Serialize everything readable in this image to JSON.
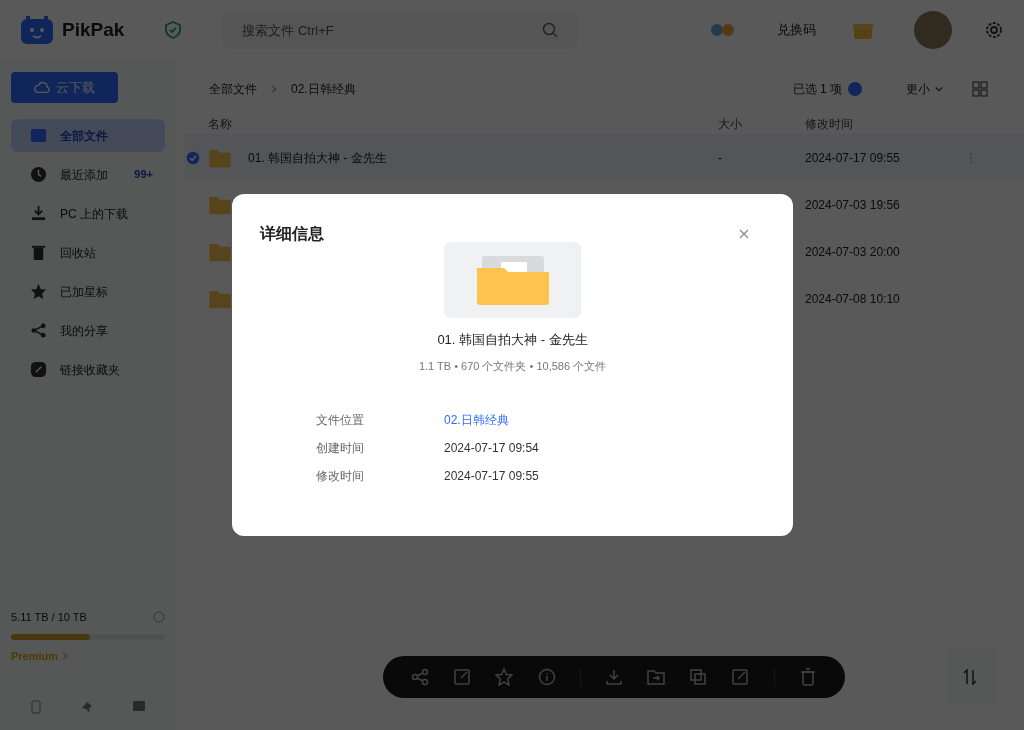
{
  "header": {
    "logo": "PikPak",
    "search": {
      "placeholder": "搜索文件 Ctrl+F"
    },
    "redeem": "兑换码"
  },
  "sidebar": {
    "cloud_download": "云下载",
    "items": [
      {
        "label": "全部文件",
        "selected": true
      },
      {
        "label": "最近添加",
        "selected": false,
        "badge": "99+"
      },
      {
        "label": "PC 上的下载",
        "selected": false
      },
      {
        "label": "回收站",
        "selected": false
      },
      {
        "label": "已加星标",
        "selected": false
      },
      {
        "label": "我的分享",
        "selected": false
      },
      {
        "label": "链接收藏夹",
        "selected": false
      }
    ],
    "storage": {
      "text": "5.11 TB / 10 TB",
      "level": 0.51,
      "plan": "Premium"
    }
  },
  "breadcrumb": [
    "全部文件",
    "02.日韩经典"
  ],
  "selection": {
    "text": "已选 1 项",
    "sort": "更小"
  },
  "table": {
    "columns": [
      "名称",
      "大小",
      "修改时间"
    ],
    "rows": [
      {
        "name": "01. 韩国自拍大神 - 金先生",
        "size": "-",
        "modified": "2024-07-17 09:55",
        "selected": true
      },
      {
        "modified": "2024-07-03 19:56",
        "selected": false
      },
      {
        "modified": "2024-07-03 20:00",
        "selected": false
      },
      {
        "modified": "2024-07-08 10:10",
        "selected": false
      }
    ]
  },
  "dialog": {
    "title": "详细信息",
    "name": "01. 韩国自拍大神 - 金先生",
    "summary": "1.1 TB • 670 个文件夹 • 10,586 个文件",
    "fields": [
      {
        "label": "文件位置",
        "value": "02.日韩经典",
        "kind": "link"
      },
      {
        "label": "创建时间",
        "value": "2024-07-17 09:54",
        "kind": "text"
      },
      {
        "label": "修改时间",
        "value": "2024-07-17 09:55",
        "kind": "text"
      }
    ]
  }
}
